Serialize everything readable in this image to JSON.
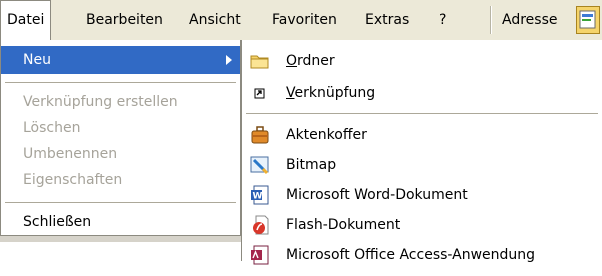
{
  "menubar": {
    "items": [
      "Datei",
      "Bearbeiten",
      "Ansicht",
      "Favoriten",
      "Extras",
      "?"
    ],
    "address_label": "Adresse"
  },
  "file_menu": {
    "new": "Neu",
    "create_shortcut": "Verknüpfung erstellen",
    "delete": "Löschen",
    "rename": "Umbenennen",
    "properties": "Eigenschaften",
    "close": "Schließen"
  },
  "new_submenu": {
    "folder_first": "O",
    "folder_rest": "rdner",
    "shortcut_first": "V",
    "shortcut_rest": "erknüpfung",
    "items": [
      {
        "label": "Aktenkoffer",
        "icon": "briefcase-icon"
      },
      {
        "label": "Bitmap",
        "icon": "bitmap-icon"
      },
      {
        "label": "Microsoft Word-Dokument",
        "icon": "word-document-icon"
      },
      {
        "label": "Flash-Dokument",
        "icon": "flash-document-icon"
      },
      {
        "label": "Microsoft Office Access-Anwendung",
        "icon": "access-database-icon"
      }
    ]
  },
  "colors": {
    "highlight": "#316ac5",
    "menubar_bg": "#ece9d8",
    "disabled_text": "#a6a39a"
  }
}
